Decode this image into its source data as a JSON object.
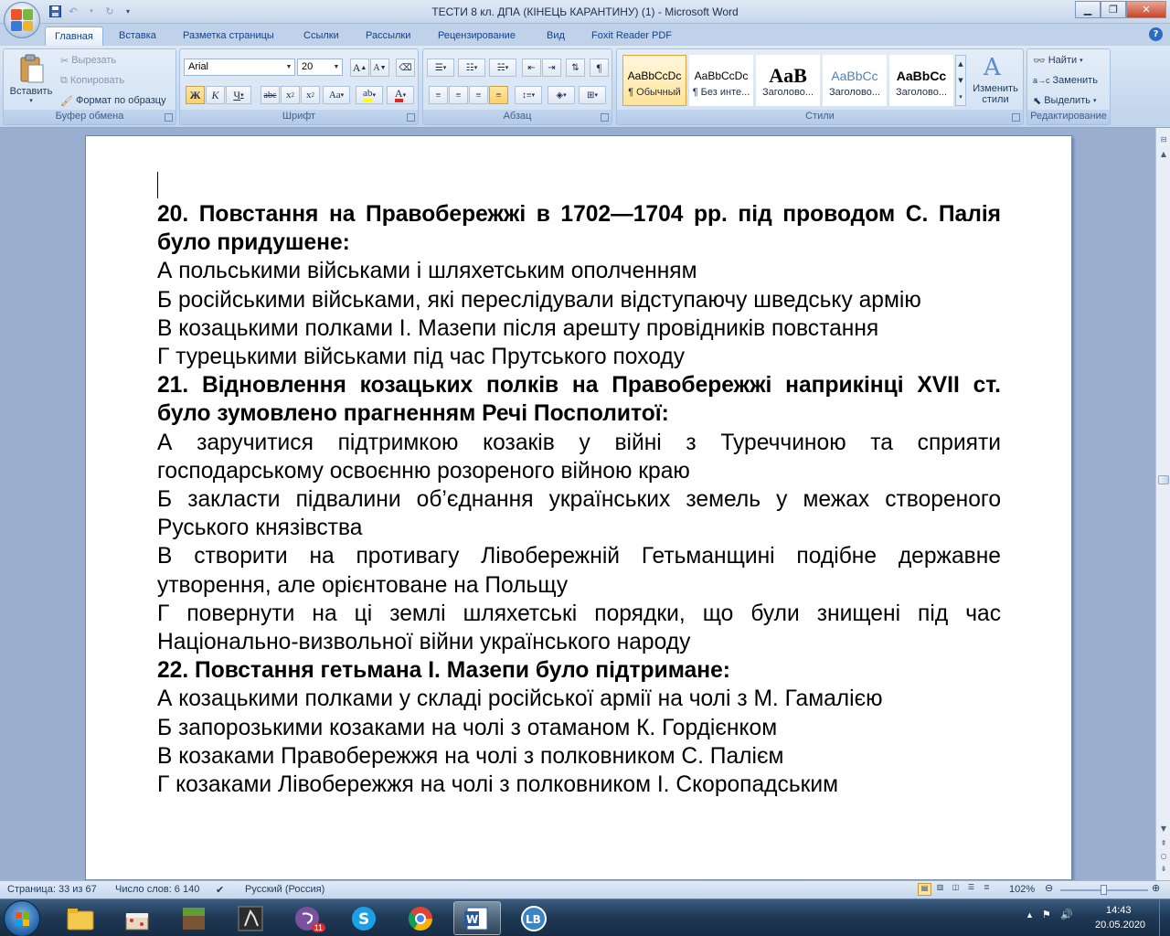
{
  "window": {
    "title": "ТЕСТИ 8 кл. ДПА (КІНЕЦЬ КАРАНТИНУ) (1) - Microsoft Word"
  },
  "tabs": [
    "Главная",
    "Вставка",
    "Разметка страницы",
    "Ссылки",
    "Рассылки",
    "Рецензирование",
    "Вид",
    "Foxit Reader PDF"
  ],
  "ribbon": {
    "clipboard": {
      "label": "Буфер обмена",
      "paste": "Вставить",
      "cut": "Вырезать",
      "copy": "Копировать",
      "format_painter": "Формат по образцу"
    },
    "font": {
      "label": "Шрифт",
      "name": "Arial",
      "size": "20"
    },
    "paragraph": {
      "label": "Абзац"
    },
    "styles": {
      "label": "Стили",
      "items": [
        {
          "sample": "AaBbCcDc",
          "name": "¶ Обычный"
        },
        {
          "sample": "AaBbCcDc",
          "name": "¶ Без инте..."
        },
        {
          "sample": "AaB",
          "name": "Заголово..."
        },
        {
          "sample": "AaBbCc",
          "name": "Заголово..."
        },
        {
          "sample": "AaBbCc",
          "name": "Заголово..."
        }
      ],
      "change": "Изменить стили"
    },
    "editing": {
      "label": "Редактирование",
      "find": "Найти",
      "replace": "Заменить",
      "select": "Выделить"
    }
  },
  "document": {
    "paragraphs": [
      {
        "bold": true,
        "text": "20. Повстання на Правобережжі в 1702—1704 рр. під проводом С. Палія було придушене:"
      },
      {
        "bold": false,
        "text": "А польськими військами і шляхетським ополченням"
      },
      {
        "bold": false,
        "text": "Б російськими військами, які переслідували відступаючу шведську армію"
      },
      {
        "bold": false,
        "text": "В козацькими полками І. Мазепи після арешту провідників повстання"
      },
      {
        "bold": false,
        "text": "Г турецькими військами під час Прутського походу"
      },
      {
        "bold": true,
        "text": "21. Відновлення козацьких полків на Правобережжі наприкінці XVII ст. було зумовлено прагненням Речі Посполитої:"
      },
      {
        "bold": false,
        "text": "А заручитися підтримкою козаків у війні з Туреччиною та сприяти господарському освоєнню розореного війною краю"
      },
      {
        "bold": false,
        "text": "Б закласти підвалини об’єднання українських земель у межах створеного Руського князівства"
      },
      {
        "bold": false,
        "text": "В створити на противагу Лівобережній Гетьманщині подібне державне утворення, але орієнтоване на Польщу"
      },
      {
        "bold": false,
        "text": "Г повернути на ці землі шляхетські порядки, що були знищені під час Національно-визвольної війни українського народу"
      },
      {
        "bold": true,
        "text": "22. Повстання гетьмана І. Мазепи було підтримане:"
      },
      {
        "bold": false,
        "text": "А козацькими полками у складі російської армії на чолі з М. Гамалією"
      },
      {
        "bold": false,
        "text": "Б запорозькими козаками на чолі з отаманом К. Гордієнком"
      },
      {
        "bold": false,
        "text": "В козаками Правобережжя на чолі з полковником С. Палієм"
      },
      {
        "bold": false,
        "text": "Г козаками Лівобережжя на чолі з полковником І. Скоропадським"
      }
    ]
  },
  "status": {
    "page": "Страница: 33 из 67",
    "words": "Число слов: 6 140",
    "language": "Русский (Россия)",
    "zoom": "102%"
  },
  "taskbar": {
    "viber_badge": "11",
    "time": "14:43",
    "date": "20.05.2020"
  },
  "colors": {
    "accent": "#15428b",
    "ribbon": "#c6d9ef",
    "taskbar": "#1f3a57"
  }
}
